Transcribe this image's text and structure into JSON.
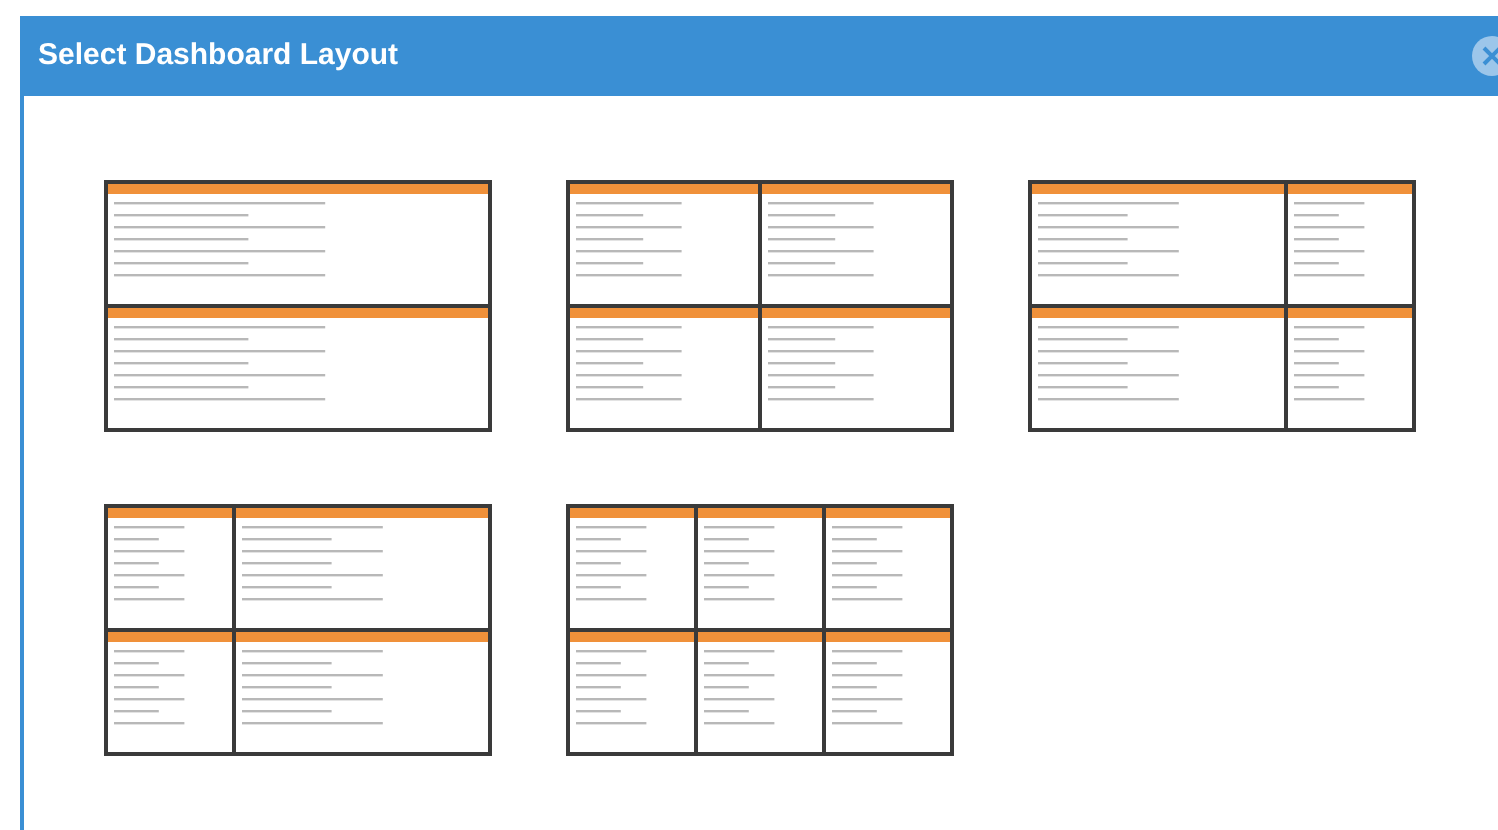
{
  "dialog": {
    "title": "Select Dashboard Layout"
  },
  "layouts": [
    {
      "kind": "rows"
    },
    {
      "kind": "quad"
    },
    {
      "kind": "wide-left"
    },
    {
      "kind": "wide-right"
    },
    {
      "kind": "grid-six"
    }
  ]
}
